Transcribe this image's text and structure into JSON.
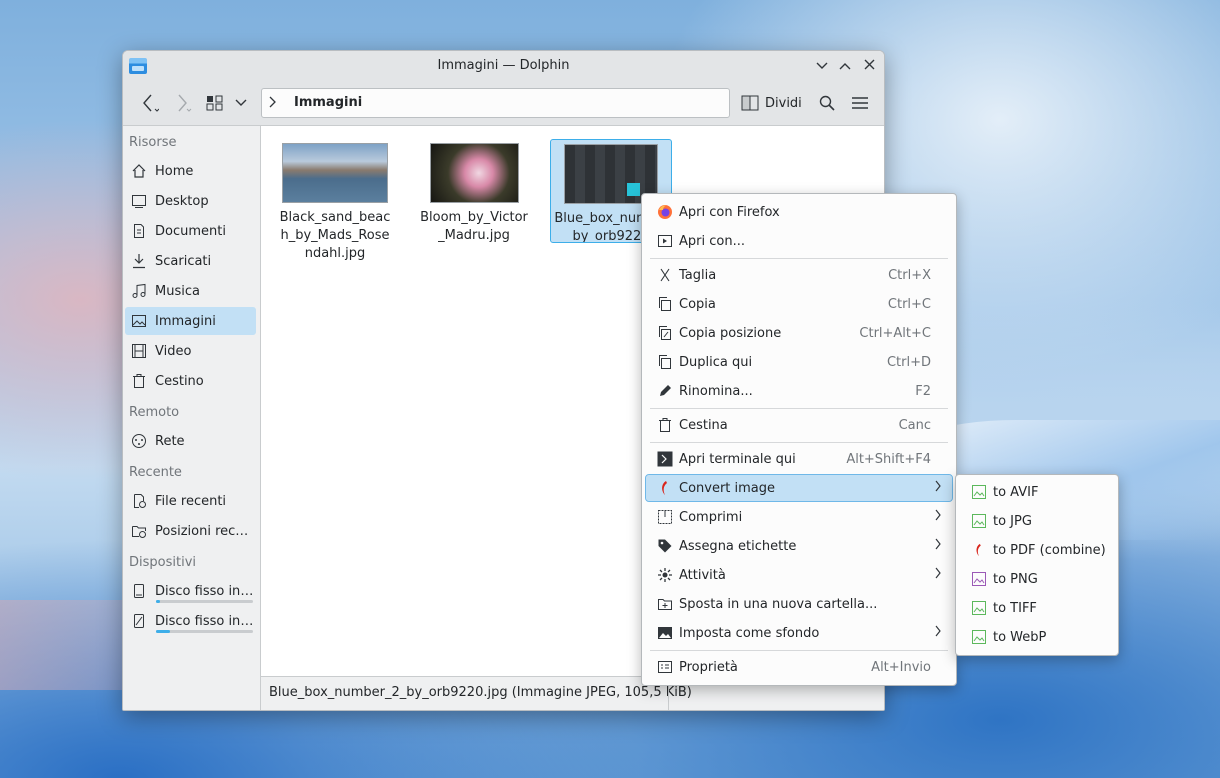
{
  "window": {
    "title": "Immagini — Dolphin"
  },
  "toolbar": {
    "breadcrumb": "Immagini",
    "split_label": "Dividi"
  },
  "sidebar": {
    "sections": [
      {
        "label": "Risorse"
      },
      {
        "label": "Remoto"
      },
      {
        "label": "Recente"
      },
      {
        "label": "Dispositivi"
      }
    ],
    "items": [
      {
        "label": "Home"
      },
      {
        "label": "Desktop"
      },
      {
        "label": "Documenti"
      },
      {
        "label": "Scaricati"
      },
      {
        "label": "Musica"
      },
      {
        "label": "Immagini"
      },
      {
        "label": "Video"
      },
      {
        "label": "Cestino"
      },
      {
        "label": "Rete"
      },
      {
        "label": "File recenti"
      },
      {
        "label": "Posizioni rece..."
      },
      {
        "label": "Disco fisso int...",
        "usage": 0.04
      },
      {
        "label": "Disco fisso int...",
        "usage": 0.14
      }
    ]
  },
  "files": [
    {
      "name": "Black_sand_beach_by_Mads_Rosendahl.jpg"
    },
    {
      "name": "Bloom_by_Victor_Madru.jpg"
    },
    {
      "name": "Blue_box_number_2_by_orb9220.jpg",
      "display_name": "Blue_box_num 2_by_orb9220"
    }
  ],
  "status": {
    "text": "Blue_box_number_2_by_orb9220.jpg (Immagine JPEG, 105,5 KiB)"
  },
  "context_menu": {
    "items": [
      {
        "label": "Apri con Firefox",
        "shortcut": ""
      },
      {
        "label": "Apri con...",
        "shortcut": ""
      },
      {
        "label": "Taglia",
        "shortcut": "Ctrl+X"
      },
      {
        "label": "Copia",
        "shortcut": "Ctrl+C"
      },
      {
        "label": "Copia posizione",
        "shortcut": "Ctrl+Alt+C"
      },
      {
        "label": "Duplica qui",
        "shortcut": "Ctrl+D"
      },
      {
        "label": "Rinomina...",
        "shortcut": "F2"
      },
      {
        "label": "Cestina",
        "shortcut": "Canc"
      },
      {
        "label": "Apri terminale qui",
        "shortcut": "Alt+Shift+F4"
      },
      {
        "label": "Convert image",
        "shortcut": ""
      },
      {
        "label": "Comprimi",
        "shortcut": ""
      },
      {
        "label": "Assegna etichette",
        "shortcut": ""
      },
      {
        "label": "Attività",
        "shortcut": ""
      },
      {
        "label": "Sposta in una nuova cartella...",
        "shortcut": ""
      },
      {
        "label": "Imposta come sfondo",
        "shortcut": ""
      },
      {
        "label": "Proprietà",
        "shortcut": "Alt+Invio"
      }
    ]
  },
  "submenu": {
    "items": [
      {
        "label": "to AVIF",
        "icon": "image-icon"
      },
      {
        "label": "to JPG",
        "icon": "image-icon"
      },
      {
        "label": "to PDF (combine)",
        "icon": "pdf-icon"
      },
      {
        "label": "to PNG",
        "icon": "image-icon"
      },
      {
        "label": "to TIFF",
        "icon": "image-icon"
      },
      {
        "label": "to WebP",
        "icon": "image-icon"
      }
    ]
  },
  "colors": {
    "accent": "#3daee9",
    "selection": "#c2e0f5",
    "image_icon": "#5cb85c",
    "png_icon": "#9b59b6",
    "pdf_icon": "#d9251c"
  }
}
